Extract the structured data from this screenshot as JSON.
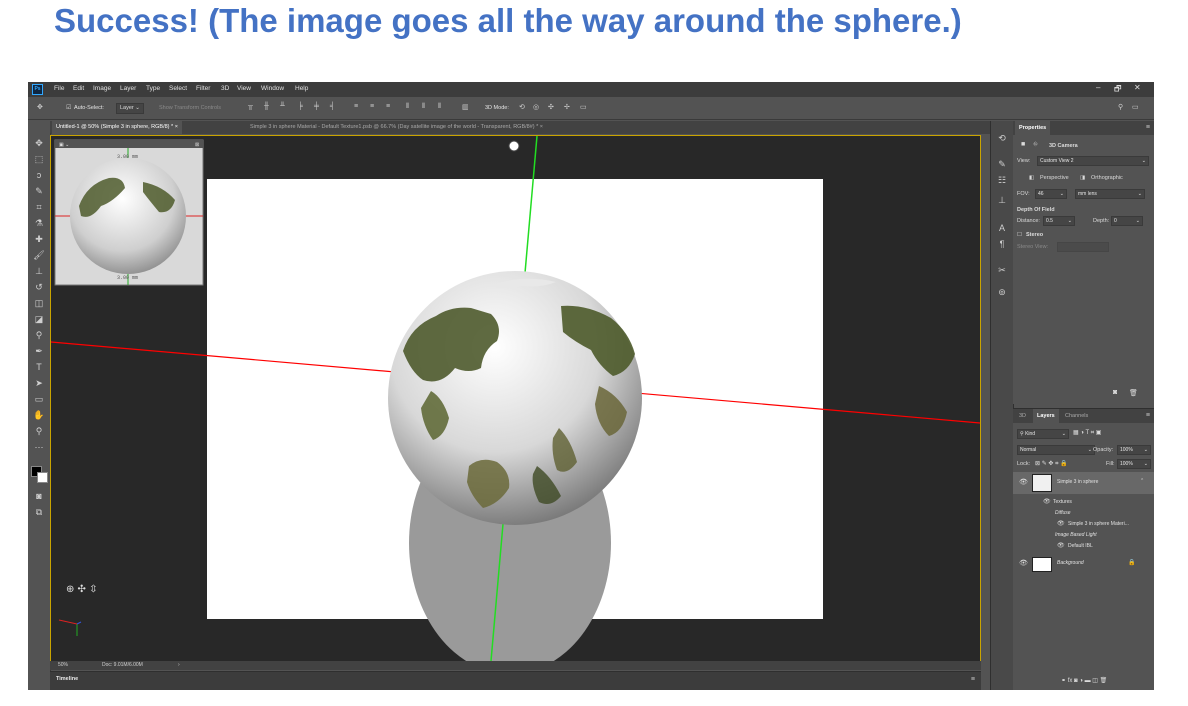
{
  "headline": "Success!  (The image goes all the way around the sphere.)",
  "colors": {
    "headline": "#4472c4",
    "x_axis": "#ff0000",
    "y_axis": "#22dd22",
    "active_border": "#c9a400"
  },
  "app": {
    "logo": "Ps",
    "menu": [
      "File",
      "Edit",
      "Image",
      "Layer",
      "Type",
      "Select",
      "Filter",
      "3D",
      "View",
      "Window",
      "Help"
    ],
    "window_controls": [
      "–",
      "🗗",
      "✕"
    ]
  },
  "options_bar": {
    "auto_select_label": "Auto-Select:",
    "auto_select_value": "Layer",
    "show_transform": "Show Transform Controls",
    "mode_label": "3D Mode:"
  },
  "tabs": [
    {
      "label": "Untitled-1 @ 50% (Simple 3 in sphere, RGB/8) *",
      "close": "×"
    },
    {
      "label": "Simple 3 in sphere Material - Default Texture1.psb @ 66.7% (Day satellite image of the world - Transparent, RGB/8#) *",
      "close": "×"
    }
  ],
  "secondary_view": {
    "measure": "3.00 mm"
  },
  "status": {
    "zoom": "50%",
    "doc": "Doc: 9.01M/6.00M",
    "arrow": "›"
  },
  "timeline": {
    "label": "Timeline"
  },
  "properties": {
    "tab": "Properties",
    "section": "3D Camera",
    "view_label": "View:",
    "view_value": "Custom View 2",
    "perspective": "Perspective",
    "orthographic": "Orthographic",
    "fov_label": "FOV:",
    "fov_value": "46",
    "lens_value": "mm lens",
    "dof_title": "Depth Of Field",
    "distance_label": "Distance:",
    "distance_value": "0.5",
    "depth_label": "Depth:",
    "depth_value": "0",
    "stereo_label": "Stereo",
    "stereo_view_label": "Stereo View:"
  },
  "layers_panel": {
    "tabs": [
      "3D",
      "Layers",
      "Channels"
    ],
    "filter": "Kind",
    "blend": "Normal",
    "opacity_label": "Opacity:",
    "opacity_value": "100%",
    "lock_label": "Lock:",
    "fill_label": "Fill:",
    "fill_value": "100%",
    "layers": [
      {
        "name": "Simple 3 in sphere",
        "level": 0
      },
      {
        "name": "Textures",
        "level": 1
      },
      {
        "name": "Diffuse",
        "level": 2
      },
      {
        "name": "Simple 3 in sphere Materi...",
        "level": 3
      },
      {
        "name": "Image Based Light",
        "level": 2
      },
      {
        "name": "Default IBL",
        "level": 3
      },
      {
        "name": "Background",
        "level": 0
      }
    ]
  }
}
